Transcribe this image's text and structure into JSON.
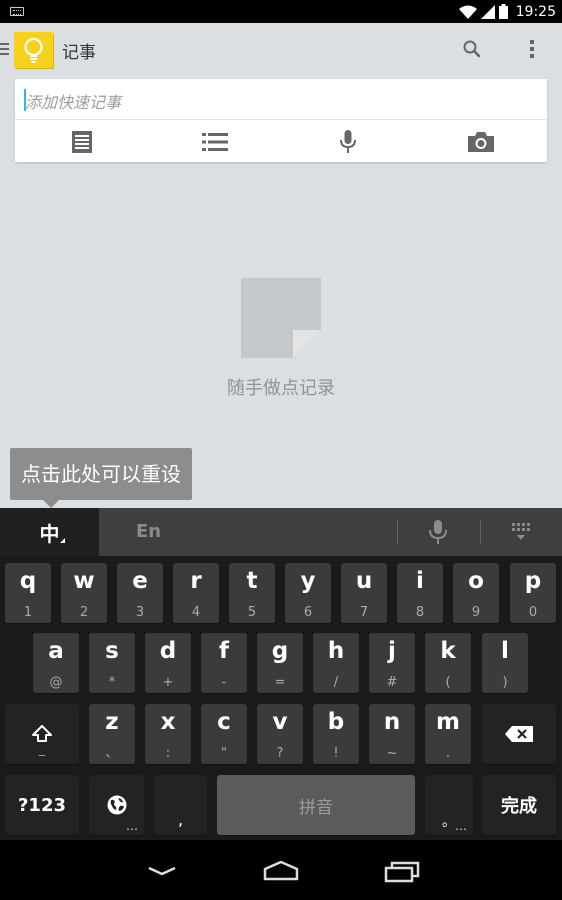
{
  "status_bar": {
    "time": "19:25",
    "icons": [
      "keyboard-icon",
      "wifi-icon",
      "signal-icon",
      "battery-icon"
    ]
  },
  "action_bar": {
    "title": "记事",
    "icons": [
      "menu-icon",
      "keep-bulb-icon",
      "search-icon",
      "overflow-menu-icon"
    ]
  },
  "note_card": {
    "input_placeholder": "添加快速记事",
    "tools": [
      "text-note-icon",
      "list-icon",
      "microphone-icon",
      "camera-icon"
    ]
  },
  "empty_state": {
    "message": "随手做点记录"
  },
  "tooltip": {
    "text": "点击此处可以重设"
  },
  "keyboard": {
    "mode_chinese": "中",
    "mode_english": "En",
    "row1": [
      {
        "main": "q",
        "sub": "1"
      },
      {
        "main": "w",
        "sub": "2"
      },
      {
        "main": "e",
        "sub": "3"
      },
      {
        "main": "r",
        "sub": "4"
      },
      {
        "main": "t",
        "sub": "5"
      },
      {
        "main": "y",
        "sub": "6"
      },
      {
        "main": "u",
        "sub": "7"
      },
      {
        "main": "i",
        "sub": "8"
      },
      {
        "main": "o",
        "sub": "9"
      },
      {
        "main": "p",
        "sub": "0"
      }
    ],
    "row2": [
      {
        "main": "a",
        "sub": "@"
      },
      {
        "main": "s",
        "sub": "*"
      },
      {
        "main": "d",
        "sub": "+"
      },
      {
        "main": "f",
        "sub": "-"
      },
      {
        "main": "g",
        "sub": "="
      },
      {
        "main": "h",
        "sub": "/"
      },
      {
        "main": "j",
        "sub": "#"
      },
      {
        "main": "k",
        "sub": "("
      },
      {
        "main": "l",
        "sub": ")"
      }
    ],
    "row3": [
      {
        "main": "z",
        "sub": "、"
      },
      {
        "main": "x",
        "sub": ":"
      },
      {
        "main": "c",
        "sub": "\""
      },
      {
        "main": "v",
        "sub": "?"
      },
      {
        "main": "b",
        "sub": "!"
      },
      {
        "main": "n",
        "sub": "~"
      },
      {
        "main": "m",
        "sub": "."
      }
    ],
    "shift_underscore": "_",
    "numbers_label": "?123",
    "globe_dots": "…",
    "comma": ",",
    "space_label": "拼音",
    "period": "。",
    "period_dots": "…",
    "done_label": "完成"
  },
  "nav_bar": {
    "icons": [
      "back-icon",
      "home-icon",
      "recent-apps-icon"
    ]
  }
}
